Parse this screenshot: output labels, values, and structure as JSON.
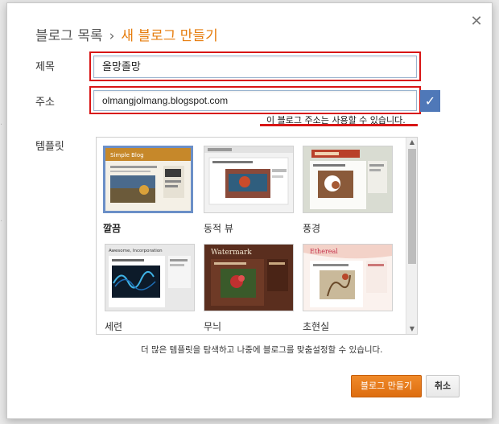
{
  "dialog": {
    "breadcrumb": {
      "parent": "블로그 목록",
      "separator": "›",
      "current": "새 블로그 만들기"
    },
    "close_icon": "close-icon",
    "title_field": {
      "label": "제목",
      "value": "올망졸망"
    },
    "address_field": {
      "label": "주소",
      "value": "olmangjolmang.blogspot.com",
      "status": "이 블로그 주소는 사용할 수 있습니다."
    },
    "template_label": "템플릿",
    "templates": [
      {
        "name": "깔끔",
        "selected": true
      },
      {
        "name": "동적 뷰",
        "selected": false
      },
      {
        "name": "풍경",
        "selected": false
      },
      {
        "name": "세련",
        "selected": false
      },
      {
        "name": "무늬",
        "selected": false
      },
      {
        "name": "초현실",
        "selected": false
      }
    ],
    "thumb_text": {
      "simple": "Simple Blog",
      "watermark": "Watermark",
      "ethereal": "Ethereal",
      "awesome": "Awesome, Incorporation"
    },
    "help_text": "더 많은 템플릿을 탐색하고 나중에 블로그를 맞춤설정할 수 있습니다.",
    "create_button": "블로그 만들기",
    "cancel_button": "취소",
    "colors": {
      "accent": "#e67c0c",
      "highlight": "#d81515",
      "check": "#4f78b8"
    }
  }
}
